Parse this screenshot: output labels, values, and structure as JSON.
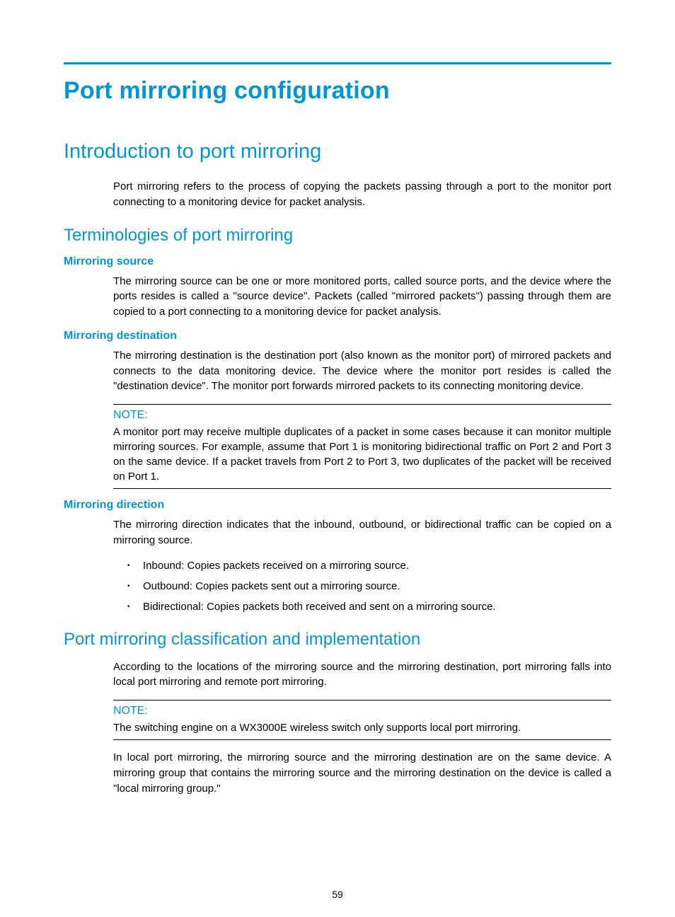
{
  "page_number": "59",
  "h1": "Port mirroring configuration",
  "h2_intro": "Introduction to port mirroring",
  "intro_para": "Port mirroring refers to the process of copying the packets passing through a port to the monitor port connecting to a monitoring device for packet analysis.",
  "h3_term": "Terminologies of port mirroring",
  "h4_source": "Mirroring source",
  "source_para": "The mirroring source can be one or more monitored ports, called source ports, and the device where the ports resides is called a \"source device\". Packets (called \"mirrored packets\") passing through them are copied to a port connecting to a monitoring device for packet analysis.",
  "h4_dest": "Mirroring destination",
  "dest_para": "The mirroring destination is the destination port (also known as the monitor port) of mirrored packets and connects to the data monitoring device. The device where the monitor port resides is called the \"destination device\". The monitor port forwards mirrored packets to its connecting monitoring device.",
  "note1_label": "NOTE:",
  "note1_text": "A monitor port may receive multiple duplicates of a packet in some cases because it can monitor multiple mirroring sources. For example, assume that Port 1 is monitoring bidirectional traffic on Port 2 and Port 3 on the same device. If a packet travels from Port 2 to Port 3, two duplicates of the packet will be received on Port 1.",
  "h4_dir": "Mirroring direction",
  "dir_para": "The mirroring direction indicates that the inbound, outbound, or bidirectional traffic can be copied on a mirroring source.",
  "dir_bullets": [
    "Inbound: Copies packets received on a mirroring source.",
    "Outbound: Copies packets sent out a mirroring source.",
    "Bidirectional: Copies packets both received and sent on a mirroring source."
  ],
  "h3_class": "Port mirroring classification and implementation",
  "class_para": "According to the locations of the mirroring source and the mirroring destination, port mirroring falls into local port mirroring and remote port mirroring.",
  "note2_label": "NOTE:",
  "note2_text": "The switching engine on a WX3000E wireless switch only supports local port mirroring.",
  "local_para": "In local port mirroring, the mirroring source and the mirroring destination are on the same device. A mirroring group that contains the mirroring source and the mirroring destination on the device is called a \"local mirroring group.\""
}
